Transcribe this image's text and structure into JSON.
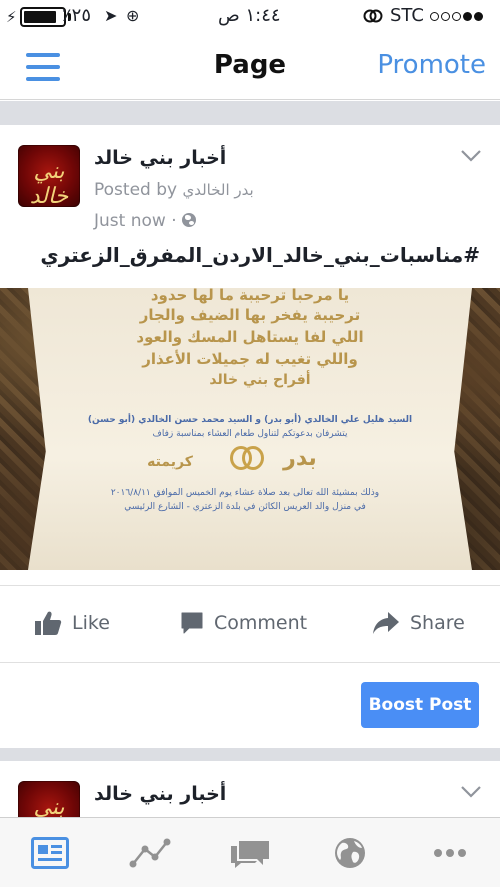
{
  "status_bar": {
    "carrier": "STC",
    "time": "١:٤٤ ص",
    "battery_percent": "٪٢٥",
    "battery_level": 0.85
  },
  "nav": {
    "title": "Page",
    "promote_label": "Promote"
  },
  "posts": [
    {
      "page_name": "أخبار بني خالد",
      "avatar_text": "بني خالد",
      "posted_by_label": "Posted by",
      "author": "بدر الخالدي",
      "time": "Just now",
      "separator": "·",
      "text": "#مناسبات_بني_خالد_الاردن_المفرق_الزعتري",
      "photo": {
        "line1": "يا مرحبا ترحيبة ما لها حدود",
        "line2": "ترحيبة يفخر بها الضيف والجار",
        "line3": "اللي لفا يستاهل المسك والعود",
        "line4": "واللي تغيب له جميلات الأعذار",
        "line5": "أفراح بني خالد",
        "hosts": "السيد هليل علي الخالدي (أبو بدر) و السيد محمد حسن الخالدي (أبو حسن)",
        "invite": "يتشرفان بدعوتكم لتناول طعام العشاء بمناسبة زفاف",
        "groom": "بدر",
        "bride": "كريمته",
        "details": "وذلك بمشيئة الله تعالى بعد صلاة عشاء يوم الخميس الموافق ٢٠١٦/٨/١١",
        "place": "في منزل والد العريس الكائن في بلدة الزعتري - الشارع الرئيسي"
      }
    },
    {
      "page_name": "أخبار بني خالد",
      "avatar_text": "بني خالد"
    }
  ],
  "actions": {
    "like": "Like",
    "comment": "Comment",
    "share": "Share"
  },
  "boost": {
    "label": "Boost Post"
  },
  "tabs": [
    {
      "icon": "news-feed-icon",
      "active": true
    },
    {
      "icon": "insights-icon",
      "active": false
    },
    {
      "icon": "messages-icon",
      "active": false
    },
    {
      "icon": "globe-icon",
      "active": false
    },
    {
      "icon": "more-icon",
      "active": false
    }
  ],
  "colors": {
    "accent": "#4a90e2",
    "boost": "#4a8ef5",
    "muted": "#90949c",
    "tab_icon": "#929292",
    "tab_active": "#4a90e2"
  }
}
